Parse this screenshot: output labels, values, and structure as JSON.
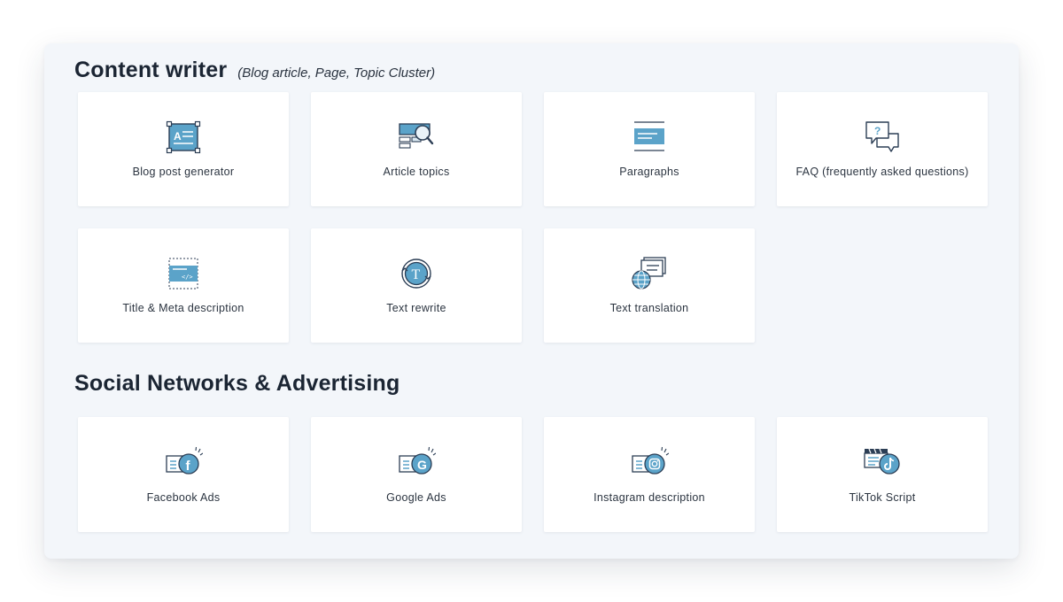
{
  "content_section": {
    "title": "Content writer",
    "subtitle": "(Blog article, Page, Topic Cluster)",
    "cards": [
      {
        "label": "Blog post generator",
        "icon": "document-edit-icon"
      },
      {
        "label": "Article topics",
        "icon": "search-topics-icon"
      },
      {
        "label": "Paragraphs",
        "icon": "paragraph-icon"
      },
      {
        "label": "FAQ (frequently asked questions)",
        "icon": "faq-chat-icon"
      },
      {
        "label": "Title & Meta description",
        "icon": "code-tag-icon"
      },
      {
        "label": "Text rewrite",
        "icon": "text-rewrite-icon"
      },
      {
        "label": "Text translation",
        "icon": "globe-translation-icon"
      }
    ]
  },
  "social_section": {
    "title": "Social Networks & Advertising",
    "cards": [
      {
        "label": "Facebook Ads",
        "icon": "facebook-icon"
      },
      {
        "label": "Google Ads",
        "icon": "google-icon"
      },
      {
        "label": "Instagram description",
        "icon": "instagram-icon"
      },
      {
        "label": "TikTok Script",
        "icon": "tiktok-icon"
      }
    ]
  },
  "colors": {
    "accent": "#5ba3c9",
    "outline": "#2c3e55",
    "panel_bg": "#f3f6fa",
    "card_bg": "#ffffff",
    "text": "#1b2533"
  }
}
